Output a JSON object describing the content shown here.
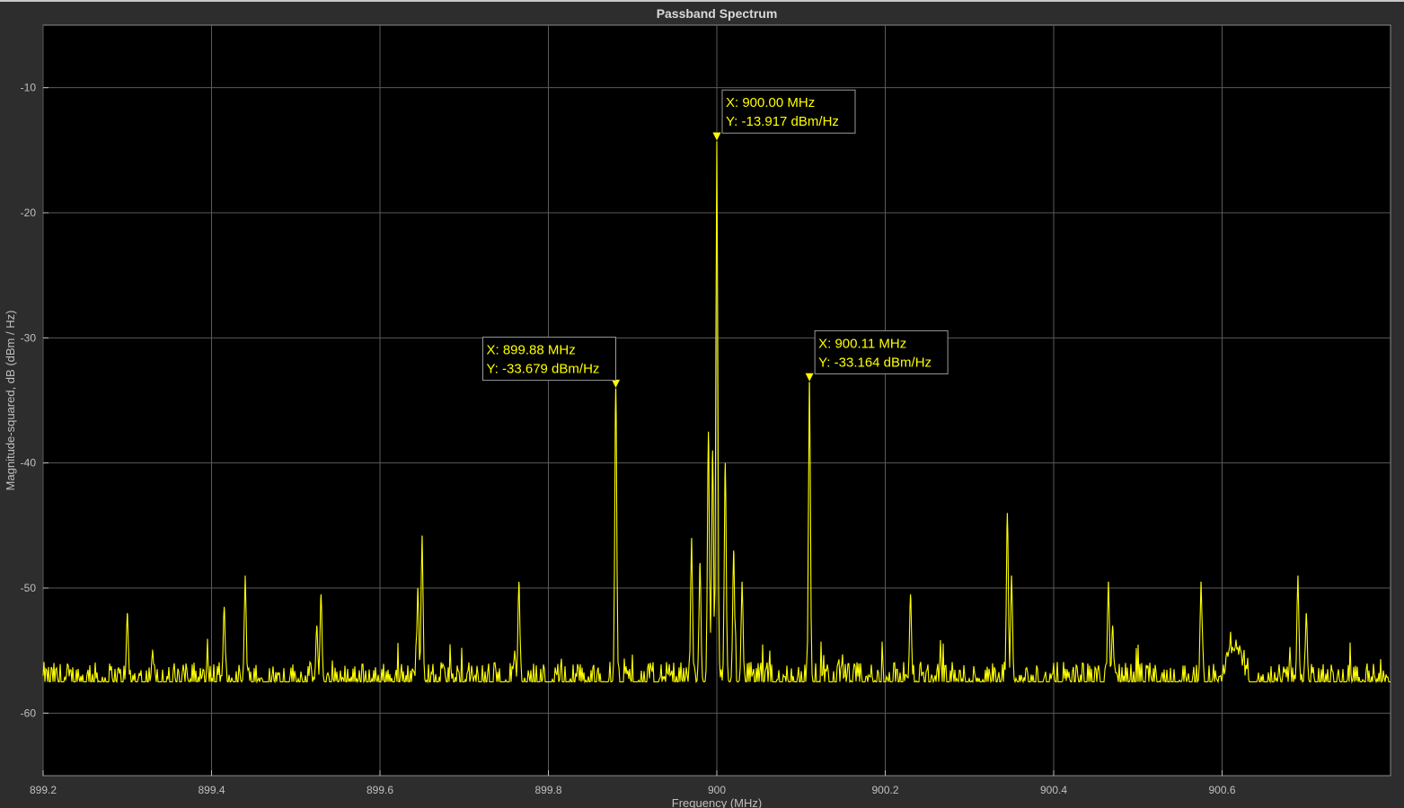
{
  "chart_data": {
    "type": "line",
    "title": "Passband Spectrum",
    "xlabel": "Frequency (MHz)",
    "ylabel": "Magnitude-squared, dB (dBm / Hz)",
    "xlim": [
      899.2,
      900.8
    ],
    "ylim": [
      -65,
      -5
    ],
    "xticks": [
      899.2,
      899.4,
      899.6,
      899.8,
      900,
      900.2,
      900.4,
      900.6
    ],
    "xtick_labels": [
      "899.2",
      "899.4",
      "899.6",
      "899.8",
      "900",
      "900.2",
      "900.4",
      "900.6"
    ],
    "yticks": [
      -10,
      -20,
      -30,
      -40,
      -50,
      -60
    ],
    "ytick_labels": [
      "-10",
      "-20",
      "-30",
      "-40",
      "-50",
      "-60"
    ],
    "grid": true,
    "colors": {
      "background": "#000000",
      "figure": "#2d2d2d",
      "grid": "#5a5a5a",
      "trace": "#ffff00",
      "text": "#bfbfbf"
    },
    "series": [
      {
        "color": "#ffff00",
        "noise_floor": -57.5,
        "peaks": [
          {
            "x": 899.3,
            "y": -52
          },
          {
            "x": 899.33,
            "y": -55
          },
          {
            "x": 899.415,
            "y": -51.5
          },
          {
            "x": 899.44,
            "y": -49
          },
          {
            "x": 899.525,
            "y": -53
          },
          {
            "x": 899.53,
            "y": -50.5
          },
          {
            "x": 899.645,
            "y": -50
          },
          {
            "x": 899.65,
            "y": -45.8
          },
          {
            "x": 899.76,
            "y": -55
          },
          {
            "x": 899.765,
            "y": -49.5
          },
          {
            "x": 899.88,
            "y": -33.679
          },
          {
            "x": 899.97,
            "y": -46
          },
          {
            "x": 899.98,
            "y": -48
          },
          {
            "x": 899.99,
            "y": -37.5
          },
          {
            "x": 899.995,
            "y": -39
          },
          {
            "x": 900.0,
            "y": -13.917
          },
          {
            "x": 900.01,
            "y": -40
          },
          {
            "x": 900.02,
            "y": -47
          },
          {
            "x": 900.03,
            "y": -49.5
          },
          {
            "x": 900.11,
            "y": -33.164
          },
          {
            "x": 900.23,
            "y": -50.5
          },
          {
            "x": 900.345,
            "y": -44
          },
          {
            "x": 900.35,
            "y": -49
          },
          {
            "x": 900.465,
            "y": -49.5
          },
          {
            "x": 900.47,
            "y": -53
          },
          {
            "x": 900.575,
            "y": -49.5
          },
          {
            "x": 900.61,
            "y": -53.5
          },
          {
            "x": 900.69,
            "y": -49
          },
          {
            "x": 900.7,
            "y": -52
          }
        ]
      }
    ],
    "datatips": [
      {
        "x": 900.0,
        "y": -13.917,
        "line1": "X: 900.00 MHz",
        "line2": "Y: -13.917 dBm/Hz",
        "box_side": "right"
      },
      {
        "x": 899.88,
        "y": -33.679,
        "line1": "X: 899.88 MHz",
        "line2": "Y: -33.679 dBm/Hz",
        "box_side": "left"
      },
      {
        "x": 900.11,
        "y": -33.164,
        "line1": "X: 900.11 MHz",
        "line2": "Y: -33.164 dBm/Hz",
        "box_side": "right"
      }
    ]
  }
}
